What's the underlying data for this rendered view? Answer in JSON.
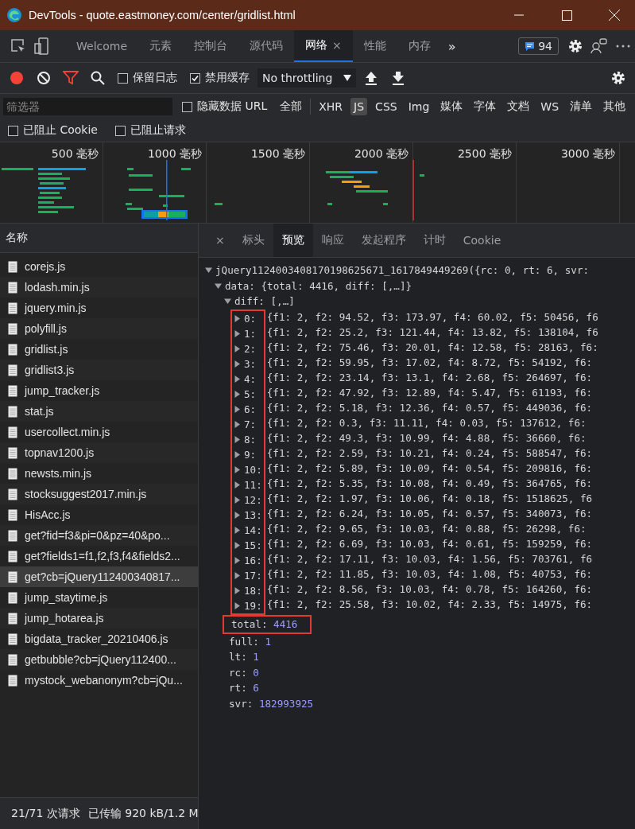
{
  "window": {
    "title": "DevTools - quote.eastmoney.com/center/gridlist.html"
  },
  "tabs": [
    {
      "label": "Welcome",
      "selected": false
    },
    {
      "label": "元素",
      "selected": false
    },
    {
      "label": "控制台",
      "selected": false
    },
    {
      "label": "源代码",
      "selected": false
    },
    {
      "label": "网络",
      "selected": true,
      "close": "×"
    },
    {
      "label": "性能",
      "selected": false
    },
    {
      "label": "内存",
      "selected": false
    }
  ],
  "tabs_overflow": "»",
  "issues_badge": "94",
  "toolbar": {
    "recording": true,
    "preserve_log": {
      "label": "保留日志",
      "checked": false
    },
    "disable_cache": {
      "label": "禁用缓存",
      "checked": true
    },
    "throttling": "No throttling"
  },
  "filter": {
    "placeholder": "筛选器",
    "hide_data_urls": {
      "label": "隐藏数据 URL",
      "checked": false
    },
    "types": [
      {
        "label": "全部",
        "selected": false
      },
      {
        "label": "XHR",
        "selected": false
      },
      {
        "label": "JS",
        "selected": true
      },
      {
        "label": "CSS",
        "selected": false
      },
      {
        "label": "Img",
        "selected": false
      },
      {
        "label": "媒体",
        "selected": false
      },
      {
        "label": "字体",
        "selected": false
      },
      {
        "label": "文档",
        "selected": false
      },
      {
        "label": "WS",
        "selected": false
      },
      {
        "label": "清单",
        "selected": false
      },
      {
        "label": "其他",
        "selected": false
      }
    ]
  },
  "blocked": [
    {
      "label": "已阻止 Cookie",
      "checked": false
    },
    {
      "label": "已阻止请求",
      "checked": false
    }
  ],
  "overview": {
    "ticks": [
      "500 毫秒",
      "1000 毫秒",
      "1500 毫秒",
      "2000 毫秒",
      "2500 毫秒",
      "3000 毫秒"
    ]
  },
  "requests": {
    "header": "名称",
    "items": [
      {
        "name": "corejs.js",
        "selected": false
      },
      {
        "name": "lodash.min.js",
        "selected": false
      },
      {
        "name": "jquery.min.js",
        "selected": false
      },
      {
        "name": "polyfill.js",
        "selected": false
      },
      {
        "name": "gridlist.js",
        "selected": false
      },
      {
        "name": "gridlist3.js",
        "selected": false
      },
      {
        "name": "jump_tracker.js",
        "selected": false
      },
      {
        "name": "stat.js",
        "selected": false
      },
      {
        "name": "usercollect.min.js",
        "selected": false
      },
      {
        "name": "topnav1200.js",
        "selected": false
      },
      {
        "name": "newsts.min.js",
        "selected": false
      },
      {
        "name": "stocksuggest2017.min.js",
        "selected": false
      },
      {
        "name": "HisAcc.js",
        "selected": false
      },
      {
        "name": "get?fid=f3&pi=0&pz=40&po...",
        "selected": false
      },
      {
        "name": "get?fields1=f1,f2,f3,f4&fields2...",
        "selected": false
      },
      {
        "name": "get?cb=jQuery112400340817...",
        "selected": true
      },
      {
        "name": "jump_staytime.js",
        "selected": false
      },
      {
        "name": "jump_hotarea.js",
        "selected": false
      },
      {
        "name": "bigdata_tracker_20210406.js",
        "selected": false
      },
      {
        "name": "getbubble?cb=jQuery112400...",
        "selected": false
      },
      {
        "name": "mystock_webanonym?cb=jQu...",
        "selected": false
      }
    ]
  },
  "status": {
    "requests": "21/71 次请求",
    "transferred": "已传输 920 kB/1.2 M"
  },
  "detail": {
    "close": "×",
    "tabs": [
      {
        "label": "标头",
        "selected": false
      },
      {
        "label": "预览",
        "selected": true
      },
      {
        "label": "响应",
        "selected": false
      },
      {
        "label": "发起程序",
        "selected": false
      },
      {
        "label": "计时",
        "selected": false
      },
      {
        "label": "Cookie",
        "selected": false
      }
    ],
    "root": {
      "text": "jQuery1124003408170198625671_1617849449269({rc: 0, rt: 6, svr:",
      "expanded": true
    },
    "data": {
      "key": "data:",
      "summary": "{total: 4416, diff: [,…]}",
      "expanded": true
    },
    "diff": {
      "key": "diff:",
      "summary": "[,…]",
      "expanded": true
    },
    "rows": [
      {
        "index": "0:",
        "value": "{f1: 2, f2: 94.52, f3: 173.97, f4: 60.02, f5: 50456, f6",
        "expanded": false
      },
      {
        "index": "1:",
        "value": "{f1: 2, f2: 25.2, f3: 121.44, f4: 13.82, f5: 138104, f6",
        "expanded": false
      },
      {
        "index": "2:",
        "value": "{f1: 2, f2: 75.46, f3: 20.01, f4: 12.58, f5: 28163, f6:",
        "expanded": false
      },
      {
        "index": "3:",
        "value": "{f1: 2, f2: 59.95, f3: 17.02, f4: 8.72, f5: 54192, f6:",
        "expanded": false
      },
      {
        "index": "4:",
        "value": "{f1: 2, f2: 23.14, f3: 13.1, f4: 2.68, f5: 264697, f6:",
        "expanded": false
      },
      {
        "index": "5:",
        "value": "{f1: 2, f2: 47.92, f3: 12.89, f4: 5.47, f5: 61193, f6:",
        "expanded": false
      },
      {
        "index": "6:",
        "value": "{f1: 2, f2: 5.18, f3: 12.36, f4: 0.57, f5: 449036, f6:",
        "expanded": false
      },
      {
        "index": "7:",
        "value": "{f1: 2, f2: 0.3, f3: 11.11, f4: 0.03, f5: 137612, f6:",
        "expanded": false
      },
      {
        "index": "8:",
        "value": "{f1: 2, f2: 49.3, f3: 10.99, f4: 4.88, f5: 36660, f6:",
        "expanded": false
      },
      {
        "index": "9:",
        "value": "{f1: 2, f2: 2.59, f3: 10.21, f4: 0.24, f5: 588547, f6:",
        "expanded": false
      },
      {
        "index": "10:",
        "value": "{f1: 2, f2: 5.89, f3: 10.09, f4: 0.54, f5: 209816, f6:",
        "expanded": false
      },
      {
        "index": "11:",
        "value": "{f1: 2, f2: 5.35, f3: 10.08, f4: 0.49, f5: 364765, f6:",
        "expanded": false
      },
      {
        "index": "12:",
        "value": "{f1: 2, f2: 1.97, f3: 10.06, f4: 0.18, f5: 1518625, f6",
        "expanded": false
      },
      {
        "index": "13:",
        "value": "{f1: 2, f2: 6.24, f3: 10.05, f4: 0.57, f5: 340073, f6:",
        "expanded": false
      },
      {
        "index": "14:",
        "value": "{f1: 2, f2: 9.65, f3: 10.03, f4: 0.88, f5: 26298, f6:",
        "expanded": false
      },
      {
        "index": "15:",
        "value": "{f1: 2, f2: 6.69, f3: 10.03, f4: 0.61, f5: 159259, f6:",
        "expanded": false
      },
      {
        "index": "16:",
        "value": "{f1: 2, f2: 17.11, f3: 10.03, f4: 1.56, f5: 703761, f6",
        "expanded": false
      },
      {
        "index": "17:",
        "value": "{f1: 2, f2: 11.85, f3: 10.03, f4: 1.08, f5: 40753, f6:",
        "expanded": false
      },
      {
        "index": "18:",
        "value": "{f1: 2, f2: 8.56, f3: 10.03, f4: 0.78, f5: 164260, f6:",
        "expanded": false
      },
      {
        "index": "19:",
        "value": "{f1: 2, f2: 25.58, f3: 10.02, f4: 2.33, f5: 14975, f6:",
        "expanded": false
      }
    ],
    "total": {
      "key": "total:",
      "value": "4416"
    },
    "fields": [
      {
        "key": "full:",
        "value": "1"
      },
      {
        "key": "lt:",
        "value": "1"
      },
      {
        "key": "rc:",
        "value": "0"
      },
      {
        "key": "rt:",
        "value": "6"
      },
      {
        "key": "svr:",
        "value": "182993925"
      }
    ]
  }
}
